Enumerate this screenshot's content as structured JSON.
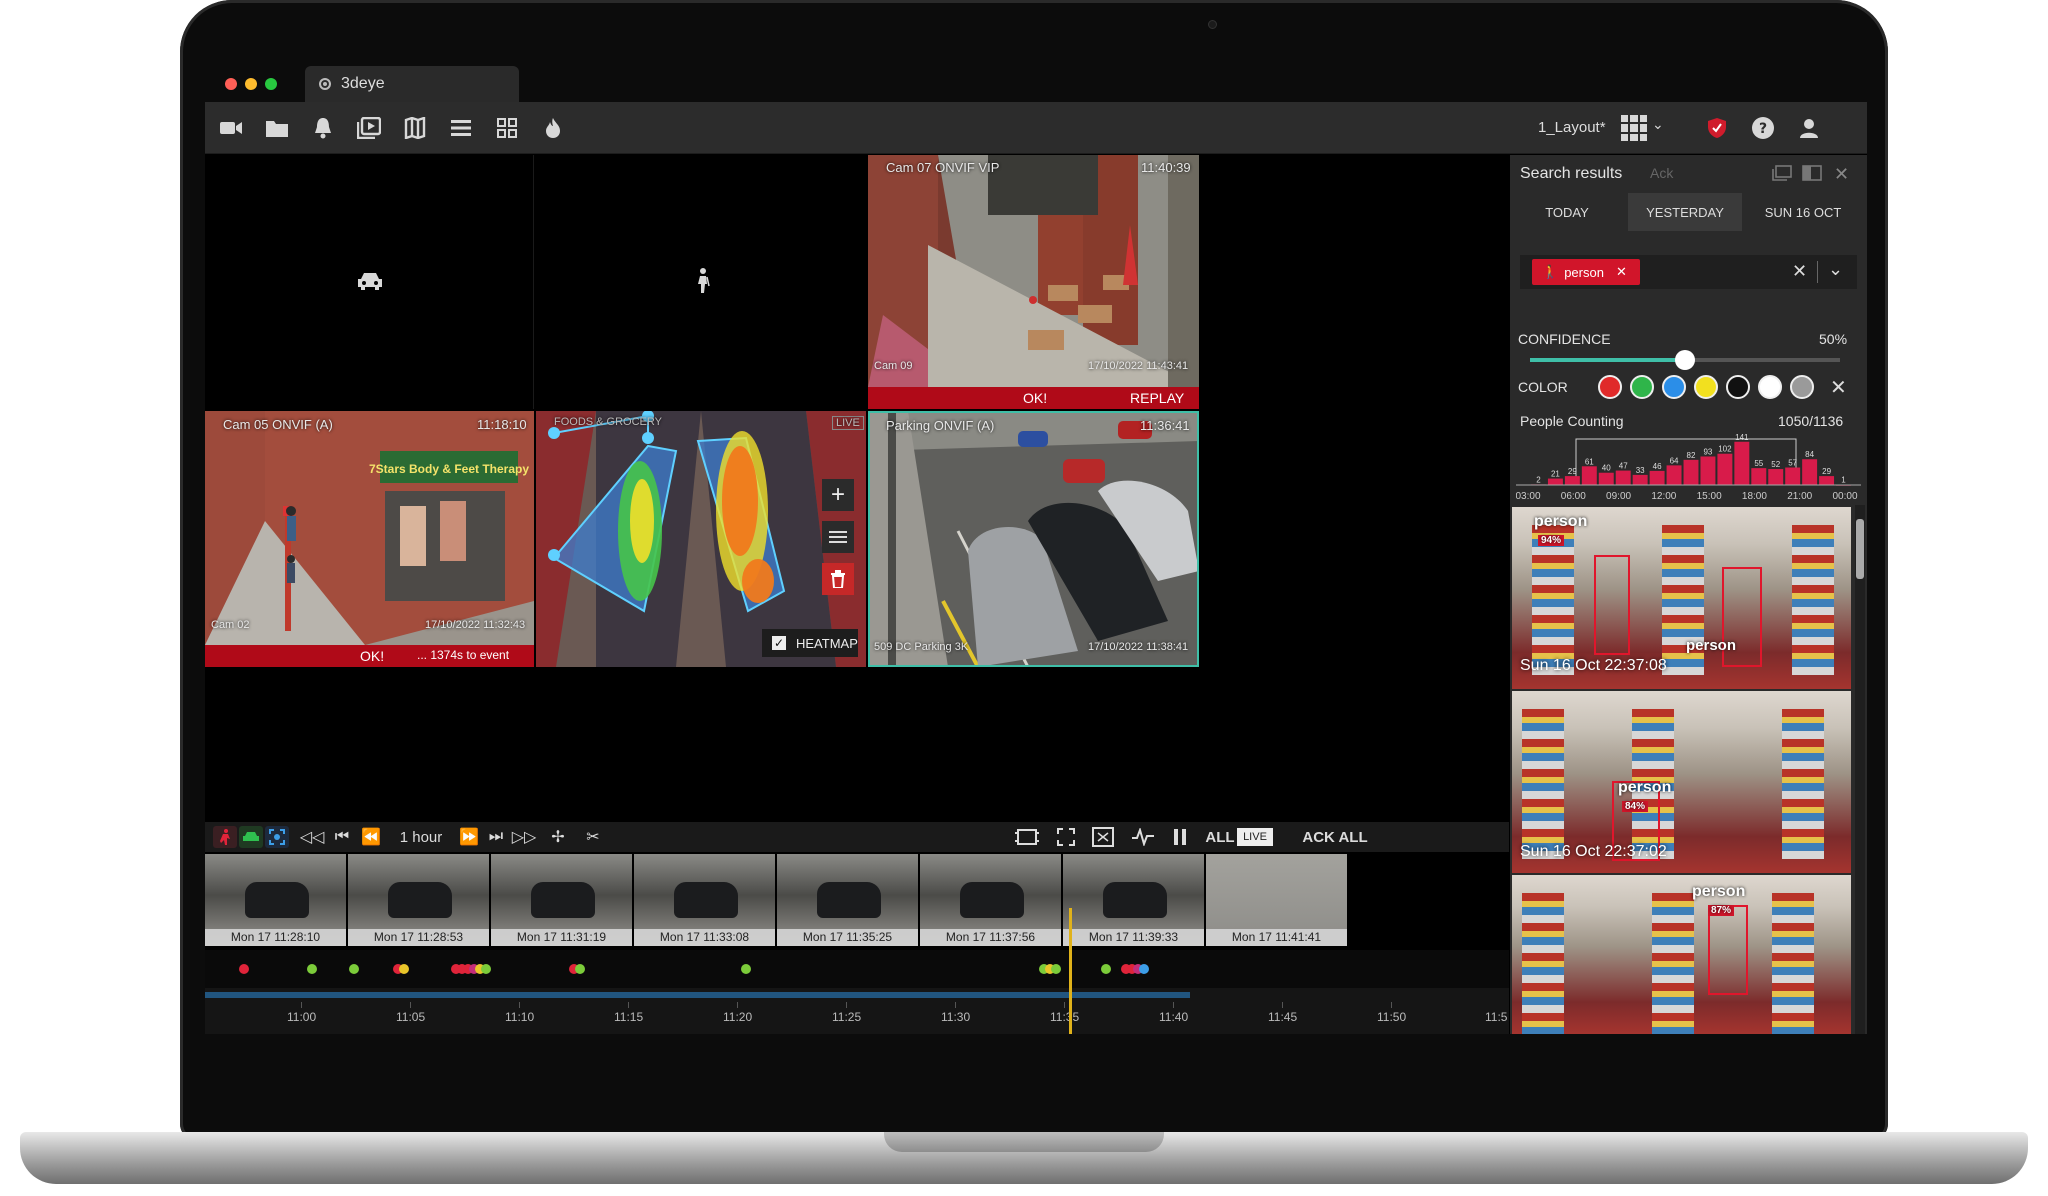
{
  "app": {
    "tab_title": "3deye"
  },
  "toolbar": {
    "layout_name": "1_Layout*"
  },
  "cameras": [
    {
      "name": "",
      "status": ""
    },
    {
      "name": "",
      "status": ""
    },
    {
      "name": "Cam 07 ONVIF VIP",
      "time": "11:40:39",
      "sub": "Cam 09",
      "stamp": "17/10/2022 11:43:41",
      "status": "OK!",
      "action": "REPLAY"
    },
    {
      "name": "Cam 05 ONVIF (A)",
      "time": "11:18:10",
      "sub": "Cam 02",
      "stamp": "17/10/2022 11:32:43",
      "status": "OK!",
      "note": "... 1374s to event",
      "sign": "7Stars Body & Feet Therapy"
    },
    {
      "name": "FOODS & GROCERY",
      "badge": "LIVE",
      "heatmap_label": "HEATMAP"
    },
    {
      "name": "Parking ONVIF (A)",
      "time": "11:36:41",
      "sub": "509 DC Parking 3K",
      "stamp": "17/10/2022 11:38:41"
    }
  ],
  "controls": {
    "range": "1 hour",
    "all": "ALL",
    "live": "LIVE",
    "ack_all": "ACK ALL"
  },
  "thumbnails": [
    "Mon 17 11:28:10",
    "Mon 17 11:28:53",
    "Mon 17 11:31:19",
    "Mon 17 11:33:08",
    "Mon 17 11:35:25",
    "Mon 17 11:37:56",
    "Mon 17 11:39:33",
    "Mon 17 11:41:41"
  ],
  "timeline_ticks": [
    "11:00",
    "11:05",
    "11:10",
    "11:15",
    "11:20",
    "11:25",
    "11:30",
    "11:35",
    "11:40",
    "11:45",
    "11:50",
    "11:5"
  ],
  "panel": {
    "title": "Search results",
    "ack": "Ack",
    "days": [
      "TODAY",
      "YESTERDAY",
      "SUN 16 OCT"
    ],
    "filter_tag": "person",
    "confidence_label": "CONFIDENCE",
    "confidence_value": "50%",
    "confidence_fraction": 0.5,
    "color_label": "COLOR",
    "colors": [
      "#e02a2a",
      "#2fb54a",
      "#2b8ee8",
      "#f2e01f",
      "#111111",
      "#ffffff",
      "#9a9a9a"
    ],
    "counting_label": "People Counting",
    "counting_value": "1050/1136",
    "results": [
      {
        "label": "person",
        "label2": "person",
        "time": "Sun 16 Oct 22:37:08",
        "conf": "94%"
      },
      {
        "label": "person",
        "time": "Sun 16 Oct 22:37:02",
        "conf": "84%"
      },
      {
        "label": "person",
        "conf": "87%"
      }
    ]
  },
  "chart_data": {
    "type": "bar",
    "title": "People Counting",
    "categories": [
      "03:00",
      "",
      "06:00",
      "",
      "09:00",
      "",
      "12:00",
      "",
      "15:00",
      "",
      "18:00",
      "",
      "21:00",
      "",
      "00:00"
    ],
    "values": [
      2,
      21,
      29,
      61,
      40,
      47,
      33,
      46,
      64,
      82,
      93,
      102,
      141,
      55,
      52,
      57,
      84,
      29,
      1
    ],
    "tick_labels": [
      "03:00",
      "06:00",
      "09:00",
      "12:00",
      "15:00",
      "18:00",
      "21:00",
      "00:00"
    ],
    "ylim": [
      0,
      150
    ],
    "grid": false,
    "bar_color": "#d81b4a"
  }
}
